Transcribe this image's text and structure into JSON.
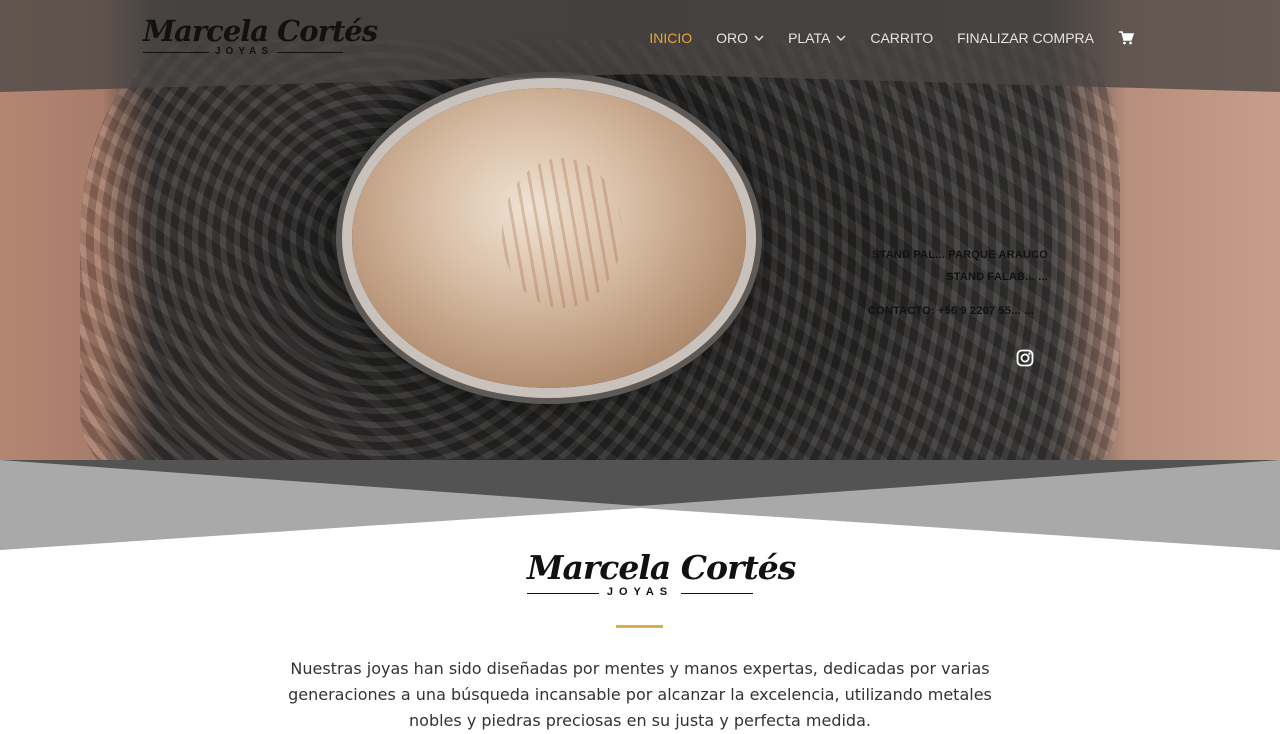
{
  "brand": {
    "logo_text": "Marcela Cortés",
    "logo_subtext": "JOYAS"
  },
  "nav": {
    "items": [
      {
        "label": "INICIO",
        "active": true,
        "dropdown": false
      },
      {
        "label": "ORO",
        "active": false,
        "dropdown": true
      },
      {
        "label": "PLATA",
        "active": false,
        "dropdown": true
      },
      {
        "label": "CARRITO",
        "active": false,
        "dropdown": false
      },
      {
        "label": "FINALIZAR COMPRA",
        "active": false,
        "dropdown": false
      }
    ],
    "cart_icon": "shopping-cart-icon"
  },
  "hero": {
    "line1": "STAND PAL... PARQUE ARAUCO",
    "line2": "STAND FALAB... ...",
    "line3": "CONTACTO: +56 9 2207 55... ...",
    "social_icon": "instagram-icon"
  },
  "content": {
    "intro": "Nuestras joyas han sido diseñadas por mentes y manos expertas, dedicadas por varias generaciones a una búsqueda incansable por alcanzar la excelencia, utilizando metales nobles y piedras preciosas en su justa y perfecta medida."
  },
  "colors": {
    "accent": "#e8a536",
    "gold_rule": "#d8b04a",
    "header_bg": "#4a4644",
    "band_dark": "#535353",
    "band_light": "#a9a9a9"
  }
}
